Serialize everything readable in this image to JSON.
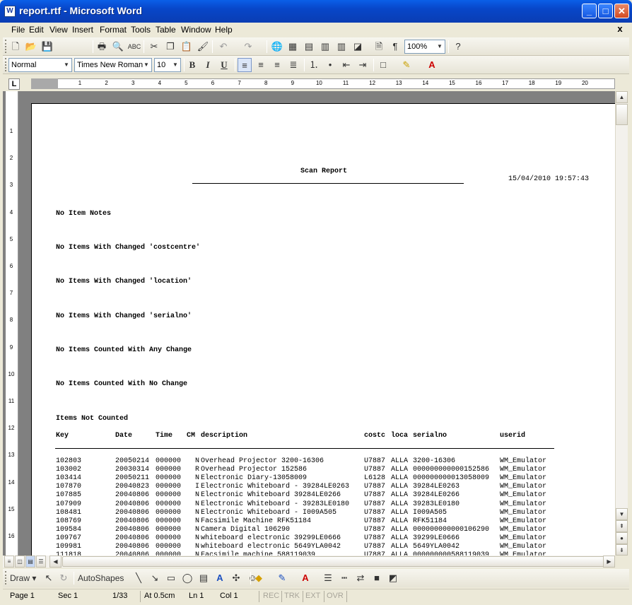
{
  "window": {
    "title": "report.rtf - Microsoft Word",
    "icon_letter": "W",
    "minimize_glyph": "_",
    "maximize_glyph": "□",
    "close_glyph": "✕"
  },
  "menu": {
    "items": [
      "File",
      "Edit",
      "View",
      "Insert",
      "Format",
      "Tools",
      "Table",
      "Window",
      "Help"
    ],
    "doc_close_glyph": "x"
  },
  "standard_toolbar": {
    "zoom": "100%"
  },
  "formatting_toolbar": {
    "style": "Normal",
    "font": "Times New Roman",
    "size": "10"
  },
  "ruler": {
    "corner": "L",
    "ticks": [
      "1",
      "2",
      "3",
      "4",
      "5",
      "6",
      "7",
      "8",
      "9",
      "10",
      "11",
      "12",
      "13",
      "14",
      "15",
      "16",
      "17",
      "18",
      "19",
      "20"
    ],
    "vticks": [
      "1",
      "2",
      "3",
      "4",
      "5",
      "6",
      "7",
      "8",
      "9",
      "10",
      "11",
      "12",
      "13",
      "14",
      "15",
      "16"
    ]
  },
  "document": {
    "title": "Scan Report",
    "timestamp": "15/04/2010 19:57:43",
    "sections": [
      "No Item Notes",
      "No Items With Changed 'costcentre'",
      "No Items With Changed 'location'",
      "No Items With Changed 'serialno'",
      "No Items Counted With Any Change",
      "No Items Counted With No Change"
    ],
    "table_title": "Items Not Counted",
    "columns": [
      "Key",
      "Date",
      "Time",
      "CM",
      "description",
      "costc",
      "loca",
      "serialno",
      "userid"
    ],
    "rows": [
      [
        "102803",
        "20050214",
        "000000",
        "N",
        "Overhead Projector 3200-16306",
        "U7887",
        "ALLA",
        "3200-16306",
        "WM_Emulator"
      ],
      [
        "103002",
        "20030314",
        "000000",
        "R",
        "Overhead Projector 152586",
        "U7887",
        "ALLA",
        "000000000000152586",
        "WM_Emulator"
      ],
      [
        "103414",
        "20050211",
        "000000",
        "N",
        "Electronic Diary-13058009",
        "L6128",
        "ALLA",
        "000000000013058009",
        "WM_Emulator"
      ],
      [
        "107870",
        "20040823",
        "000000",
        "I",
        "Electronic Whiteboard - 39284LE0263",
        "U7887",
        "ALLA",
        "39284LE0263",
        "WM_Emulator"
      ],
      [
        "107885",
        "20040806",
        "000000",
        "N",
        "Electronic Whiteboard 39284LE0266",
        "U7887",
        "ALLA",
        "39284LE0266",
        "WM_Emulator"
      ],
      [
        "107909",
        "20040806",
        "000000",
        "N",
        "Electronic Whiteboard - 39283LE0180",
        "U7887",
        "ALLA",
        "39283LE0180",
        "WM_Emulator"
      ],
      [
        "108481",
        "20040806",
        "000000",
        "N",
        "Electronic Whiteboard - I009A505",
        "U7887",
        "ALLA",
        "I009A505",
        "WM_Emulator"
      ],
      [
        "108769",
        "20040806",
        "000000",
        "N",
        "Facsimile Machine RFK51184",
        "U7887",
        "ALLA",
        "RFK51184",
        "WM_Emulator"
      ],
      [
        "109584",
        "20040806",
        "000000",
        "N",
        "Camera Digital 106290",
        "U7887",
        "ALLA",
        "000000000000106290",
        "WM_Emulator"
      ],
      [
        "109767",
        "20040806",
        "000000",
        "N",
        "whiteboard electronic 39299LE0666",
        "U7887",
        "ALLA",
        "39299LE0666",
        "WM_Emulator"
      ],
      [
        "109981",
        "20040806",
        "000000",
        "N",
        "whiteboard electronic 5649YLA0042",
        "U7887",
        "ALLA",
        "5649YLA0042",
        "WM_Emulator"
      ],
      [
        "111818",
        "20040806",
        "000000",
        "N",
        "Facsimile machine 588119039",
        "U7887",
        "ALLA",
        "000000000588119039",
        "WM_Emulator"
      ]
    ]
  },
  "drawing_toolbar": {
    "draw_label": "Draw",
    "autoshapes_label": "AutoShapes"
  },
  "status": {
    "page": "Page 1",
    "sec": "Sec 1",
    "pages": "1/33",
    "at": "At 0.5cm",
    "ln": "Ln 1",
    "col": "Col 1",
    "rec": "REC",
    "trk": "TRK",
    "ext": "EXT",
    "ovr": "OVR"
  }
}
